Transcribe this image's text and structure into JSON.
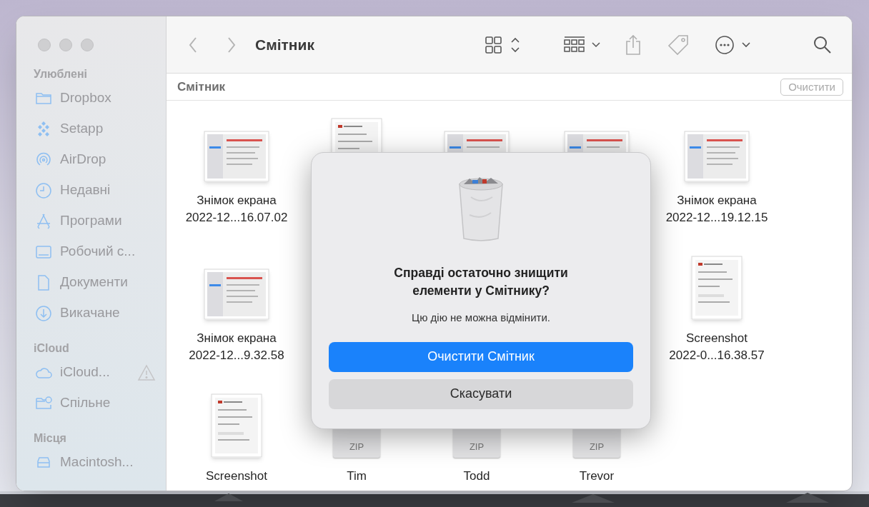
{
  "window": {
    "title": "Смітник"
  },
  "sidebar": {
    "sections": [
      {
        "title": "Улюблені",
        "items": [
          {
            "label": "Dropbox",
            "kind": "folder"
          },
          {
            "label": "Setapp",
            "kind": "setapp"
          },
          {
            "label": "AirDrop",
            "kind": "airdrop"
          },
          {
            "label": "Недавні",
            "kind": "clock"
          },
          {
            "label": "Програми",
            "kind": "apps"
          },
          {
            "label": "Робочий с...",
            "kind": "desktop"
          },
          {
            "label": "Документи",
            "kind": "document"
          },
          {
            "label": "Викачане",
            "kind": "download"
          }
        ]
      },
      {
        "title": "iCloud",
        "items": [
          {
            "label": "iCloud...",
            "kind": "cloud",
            "warning": true
          },
          {
            "label": "Спільне",
            "kind": "shared"
          }
        ]
      },
      {
        "title": "Місця",
        "items": [
          {
            "label": "Macintosh...",
            "kind": "disk"
          }
        ]
      }
    ]
  },
  "path_bar": {
    "title": "Смітник",
    "button": {
      "label": "Очистити",
      "disabled": true
    }
  },
  "files": {
    "rows": [
      [
        {
          "kind": "screenshot",
          "lines": [
            "Знімок екрана",
            "2022-12...16.07.02"
          ]
        },
        {
          "kind": "document"
        },
        {
          "kind": "screenshot"
        },
        {
          "kind": "screenshot"
        },
        {
          "kind": "screenshot",
          "lines": [
            "Знімок екрана",
            "2022-12...19.12.15"
          ]
        }
      ],
      [
        {
          "kind": "screenshot",
          "lines": [
            "Знімок екрана",
            "2022-12...9.32.58"
          ]
        },
        null,
        null,
        null,
        {
          "kind": "document",
          "lines": [
            "Screenshot",
            "2022-0...16.38.57"
          ]
        }
      ],
      [
        {
          "kind": "document",
          "lines": [
            "Screenshot"
          ]
        },
        {
          "kind": "zip",
          "badge": "ZIP",
          "lines": [
            "Tim"
          ]
        },
        {
          "kind": "zip",
          "badge": "ZIP",
          "lines": [
            "Todd"
          ]
        },
        {
          "kind": "zip",
          "badge": "ZIP",
          "lines": [
            "Trevor"
          ]
        }
      ]
    ]
  },
  "dialog": {
    "title": "Справді остаточно знищити елементи у Смітнику?",
    "message": "Цю дію не можна відмінити.",
    "buttons": [
      {
        "label": "Очистити Смітник",
        "kind": "primary"
      },
      {
        "label": "Скасувати",
        "kind": "secondary"
      }
    ]
  }
}
